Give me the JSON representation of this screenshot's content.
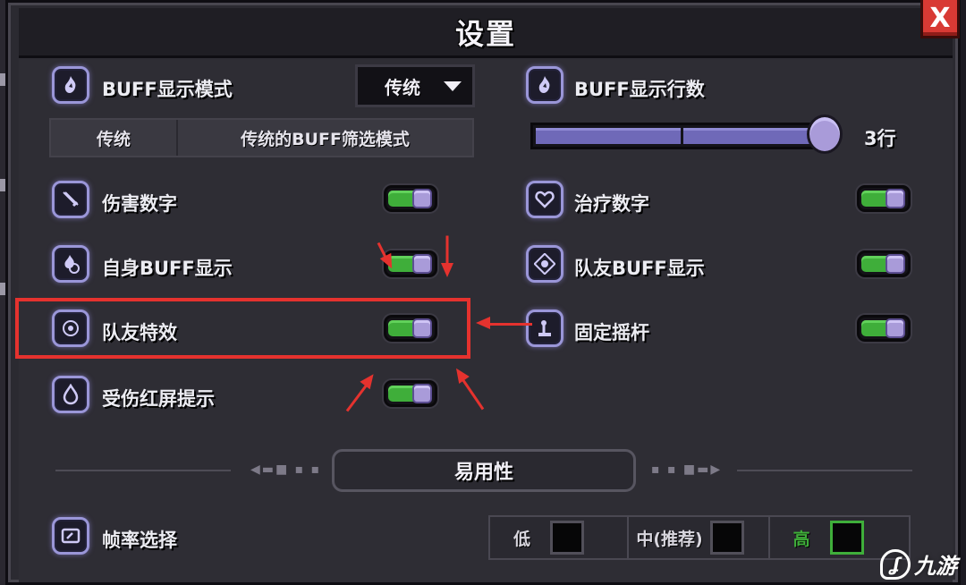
{
  "window": {
    "title": "设置",
    "close_label": "X"
  },
  "buff": {
    "display_mode_label": "BUFF显示模式",
    "dropdown_value": "传统",
    "mode_name": "传统",
    "mode_desc": "传统的BUFF筛选模式",
    "rows_label": "BUFF显示行数",
    "rows_value": "3行",
    "rows_fraction": 1.0
  },
  "settings": [
    {
      "id": "damage-numbers",
      "label": "伤害数字",
      "icon": "sword-icon",
      "on": true
    },
    {
      "id": "heal-numbers",
      "label": "治疗数字",
      "icon": "heart-icon",
      "on": true
    },
    {
      "id": "self-buff",
      "label": "自身BUFF显示",
      "icon": "self-buff-icon",
      "on": true
    },
    {
      "id": "team-buff",
      "label": "队友BUFF显示",
      "icon": "team-buff-icon",
      "on": true
    },
    {
      "id": "team-effects",
      "label": "队友特效",
      "icon": "effects-icon",
      "on": true
    },
    {
      "id": "fixed-joystick",
      "label": "固定摇杆",
      "icon": "joystick-icon",
      "on": true
    },
    {
      "id": "hurt-red-screen",
      "label": "受伤红屏提示",
      "icon": "drop-icon",
      "on": true
    }
  ],
  "section": {
    "title": "易用性"
  },
  "fps": {
    "label": "帧率选择",
    "options": [
      {
        "label": "低",
        "selected": false
      },
      {
        "label": "中(推荐)",
        "selected": false
      },
      {
        "label": "高",
        "selected": true
      }
    ]
  },
  "watermark": {
    "text": "九游"
  },
  "colors": {
    "toggle_on": "#3fae3a",
    "accent": "#9a96d8",
    "highlight": "#e5322e",
    "close": "#d83a34"
  }
}
